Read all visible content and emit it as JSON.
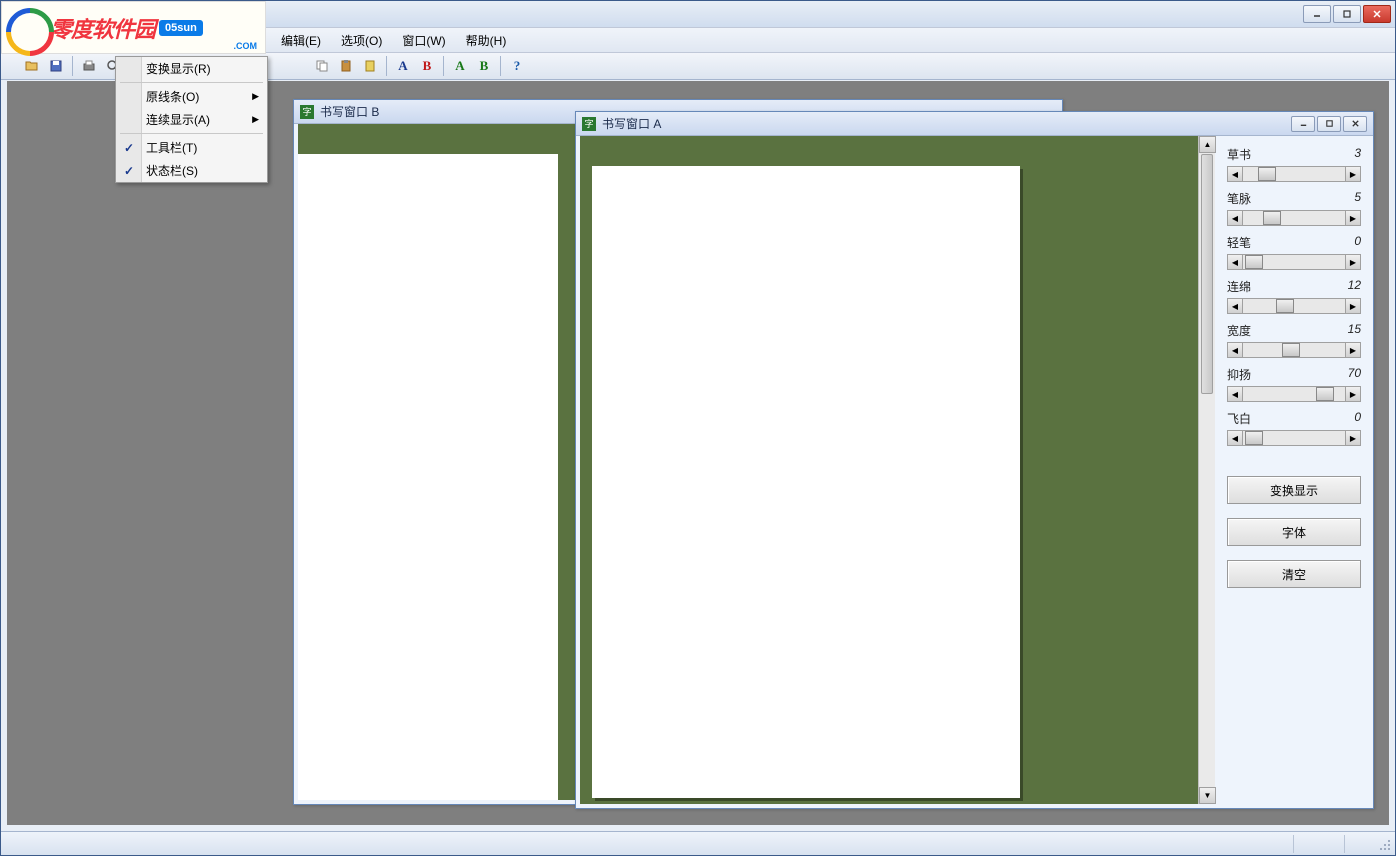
{
  "logo": {
    "text": "零度软件园",
    "badge": "05sun",
    "sub": ".COM"
  },
  "menubar": [
    "编辑(E)",
    "选项(O)",
    "窗口(W)",
    "帮助(H)"
  ],
  "dropdown": {
    "items": [
      {
        "label": "变换显示(R)",
        "checked": false,
        "arrow": false
      },
      {
        "label": "原线条(O)",
        "checked": false,
        "arrow": true
      },
      {
        "label": "连续显示(A)",
        "checked": false,
        "arrow": true
      },
      {
        "label": "工具栏(T)",
        "checked": true,
        "arrow": false
      },
      {
        "label": "状态栏(S)",
        "checked": true,
        "arrow": false
      }
    ]
  },
  "windows": {
    "b": {
      "title": "书写窗口 B"
    },
    "a": {
      "title": "书写窗口 A"
    }
  },
  "sliders": [
    {
      "label": "草书",
      "value": "3",
      "pos": 15
    },
    {
      "label": "笔脉",
      "value": "5",
      "pos": 20
    },
    {
      "label": "轻笔",
      "value": "0",
      "pos": 2
    },
    {
      "label": "连绵",
      "value": "12",
      "pos": 32
    },
    {
      "label": "宽度",
      "value": "15",
      "pos": 38
    },
    {
      "label": "抑扬",
      "value": "70",
      "pos": 72
    },
    {
      "label": "飞白",
      "value": "0",
      "pos": 2
    }
  ],
  "panel_buttons": [
    "变换显示",
    "字体",
    "清空"
  ],
  "toolbar_ab": [
    {
      "a": "A",
      "b": "B",
      "class": "ab-blue"
    },
    {
      "a": "A",
      "b": "B",
      "class": "ab-green"
    }
  ],
  "help_icon": "?"
}
